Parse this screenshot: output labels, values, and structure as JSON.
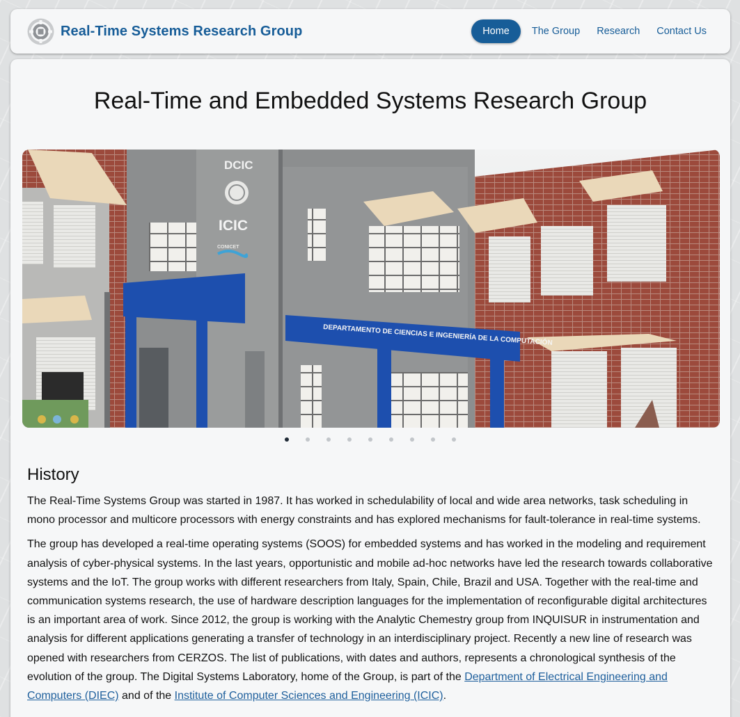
{
  "navbar": {
    "brand_title": "Real-Time Systems Research Group",
    "logo_icon": "gear-logo-icon",
    "items": [
      {
        "label": "Home",
        "active": true
      },
      {
        "label": "The Group",
        "active": false
      },
      {
        "label": "Research",
        "active": false
      },
      {
        "label": "Contact Us",
        "active": false
      }
    ]
  },
  "main": {
    "title": "Real-Time and Embedded Systems Research Group",
    "hero": {
      "sign_dcic": "DCIC",
      "sign_icic": "ICIC",
      "sign_conicet": "CONICET",
      "sign_building": "DEPARTAMENTO DE CIENCIAS E INGENIERÍA DE LA COMPUTACIÓN"
    },
    "carousel": {
      "count": 9,
      "active_index": 0
    },
    "history": {
      "heading": "History",
      "p1": "The Real-Time Systems Group was started in 1987. It has worked in schedulability of local and wide area networks, task scheduling in mono processor and multicore processors with energy constraints and has explored mechanisms for fault-tolerance in real-time systems.",
      "p2_text": "The group has developed a real-time operating systems (SOOS) for embedded systems and has worked in the modeling and requirement analysis of cyber-physical systems. In the last years, opportunistic and mobile ad-hoc networks have led the research towards collaborative systems and the IoT. The group works with different researchers from Italy, Spain, Chile, Brazil and USA. Together with the real-time and communication systems research, the use of hardware description languages for the implementation of reconfigurable digital architectures is an important area of work. Since 2012, the group is working with the Analytic Chemestry group from INQUISUR in instrumentation and analysis for different applications generating a transfer of technology in an interdisciplinary project. Recently a new line of research was opened with researchers from CERZOS. The list of publications, with dates and authors, represents a chronological synthesis of the evolution of the group. The Digital Systems Laboratory, home of the Group, is part of the ",
      "link_diec": "Department of Electrical Engineering and Computers (DIEC)",
      "p2_mid": " and of the ",
      "link_icic": "Institute of Computer Sciences and Engineering (ICIC)",
      "p2_end": "."
    }
  },
  "colors": {
    "accent": "#175d98",
    "card_bg": "#f6f7f8",
    "link": "#1e5f9c",
    "building_blue": "#1d4fae"
  }
}
